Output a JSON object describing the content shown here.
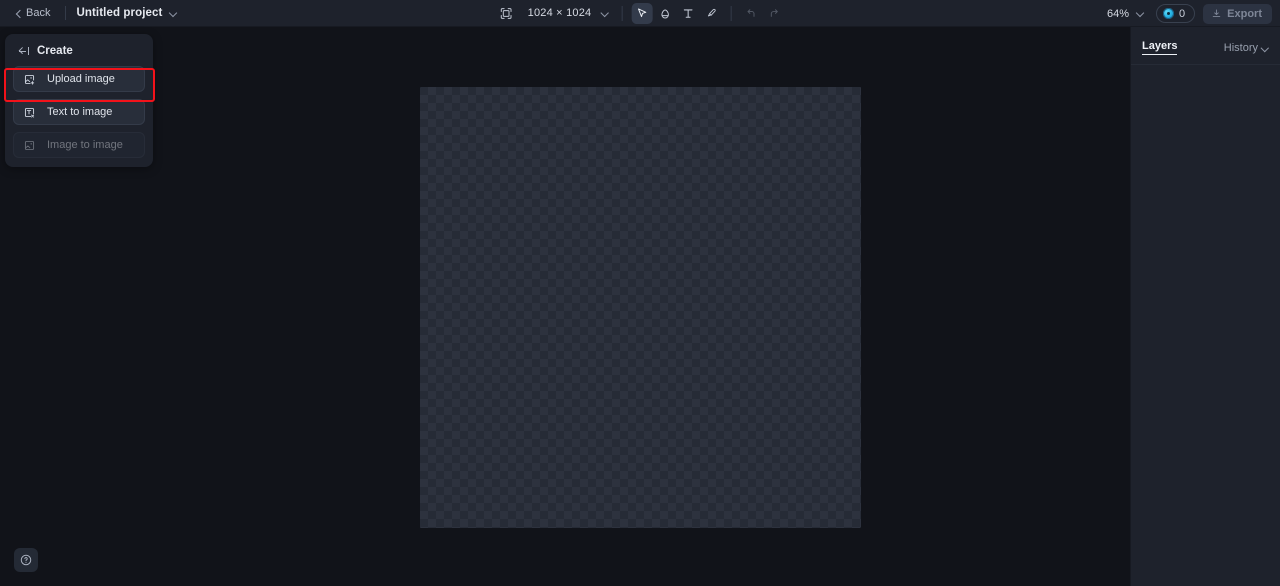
{
  "topbar": {
    "back_label": "Back",
    "back_icon": "chevron-left-icon",
    "project_name": "Untitled project",
    "project_caret_icon": "chevron-down-icon",
    "frame_icon": "artboard-frame-icon",
    "canvas_size": "1024 × 1024",
    "canvas_size_caret_icon": "chevron-down-icon",
    "tools": [
      {
        "name": "select-tool",
        "icon": "cursor-arrow-icon",
        "active": true
      },
      {
        "name": "erase-tool",
        "icon": "eraser-icon",
        "active": false
      },
      {
        "name": "text-tool",
        "icon": "text-t-icon",
        "active": false
      },
      {
        "name": "brush-tool",
        "icon": "paint-brush-icon",
        "active": false
      }
    ],
    "undo_icon": "undo-arrow-icon",
    "redo_icon": "redo-arrow-icon",
    "zoom_level": "64%",
    "zoom_caret_icon": "chevron-down-icon",
    "credits_icon": "credit-token-icon",
    "credits_count": "0",
    "export_icon": "download-icon",
    "export_label": "Export"
  },
  "create_panel": {
    "collapse_icon": "collapse-panel-icon",
    "title": "Create",
    "items": [
      {
        "label": "Upload image",
        "icon": "image-upload-icon",
        "disabled": false,
        "highlighted": true
      },
      {
        "label": "Text to image",
        "icon": "text-to-image-icon",
        "disabled": false,
        "highlighted": false
      },
      {
        "label": "Image to image",
        "icon": "image-to-image-icon",
        "disabled": true,
        "highlighted": false
      }
    ]
  },
  "canvas": {
    "artboard_name": "transparent-artboard",
    "background_pattern": "checkerboard-transparency"
  },
  "right_panel": {
    "layers_tab": "Layers",
    "history_tab": "History",
    "history_caret_icon": "chevron-down-icon"
  },
  "help": {
    "icon": "help-circle-icon"
  },
  "colors": {
    "app_background": "#111319",
    "panel_background": "#1e222c",
    "button_fill": "#282e3a",
    "accent_highlight": "#f3121a",
    "token_accent": "#29b6e6",
    "text_primary": "#e6e9ef",
    "text_muted": "#98a0ae"
  }
}
